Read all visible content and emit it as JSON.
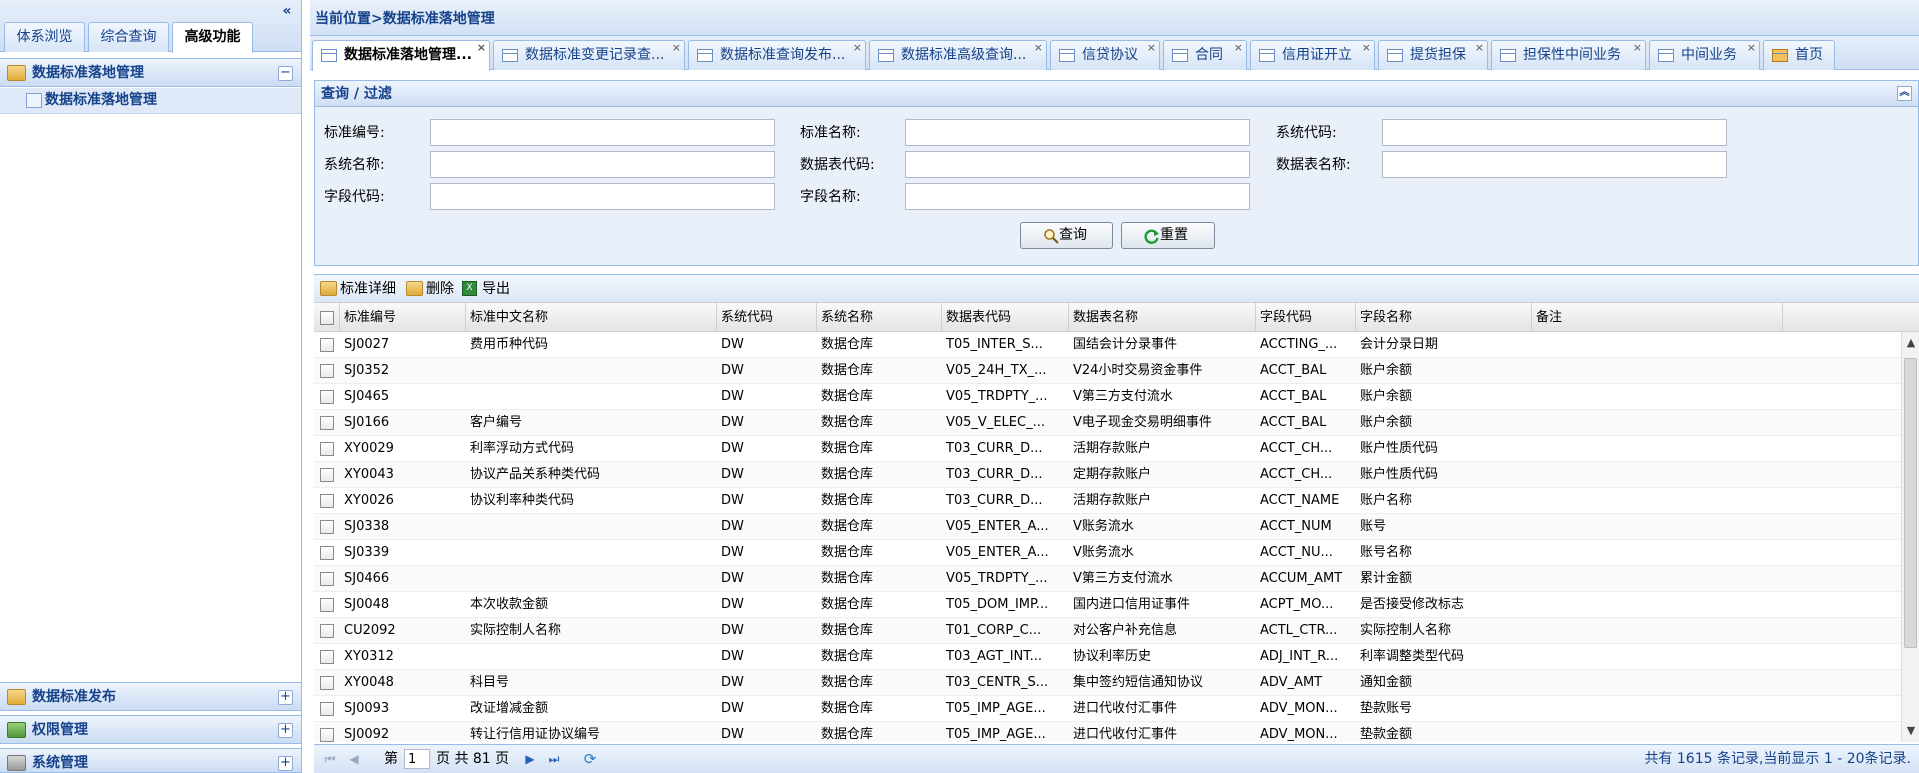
{
  "left": {
    "tabs": [
      "体系浏览",
      "综合查询",
      "高级功能"
    ],
    "collapse_glyph": "«",
    "sections": [
      {
        "label": "数据标准落地管理",
        "toggle": "−"
      },
      {
        "label": "数据标准发布",
        "toggle": "+"
      },
      {
        "label": "权限管理",
        "toggle": "+"
      },
      {
        "label": "系统管理",
        "toggle": "+"
      }
    ],
    "tree_item": "数据标准落地管理"
  },
  "breadcrumb": "当前位置>数据标准落地管理",
  "tabs": [
    {
      "label": "数据标准落地管理..."
    },
    {
      "label": "数据标准变更记录查..."
    },
    {
      "label": "数据标准查询发布..."
    },
    {
      "label": "数据标准高级查询..."
    },
    {
      "label": "信贷协议"
    },
    {
      "label": "合同"
    },
    {
      "label": "信用证开立"
    },
    {
      "label": "提货担保"
    },
    {
      "label": "担保性中间业务"
    },
    {
      "label": "中间业务"
    },
    {
      "label": "首页"
    }
  ],
  "filter": {
    "title": "查询 / 过滤",
    "fields": {
      "std_no": {
        "label": "标准编号:",
        "value": ""
      },
      "std_name": {
        "label": "标准名称:",
        "value": ""
      },
      "sys_code": {
        "label": "系统代码:",
        "value": ""
      },
      "sys_name": {
        "label": "系统名称:",
        "value": ""
      },
      "table_code": {
        "label": "数据表代码:",
        "value": ""
      },
      "table_name": {
        "label": "数据表名称:",
        "value": ""
      },
      "field_code": {
        "label": "字段代码:",
        "value": ""
      },
      "field_name": {
        "label": "字段名称:",
        "value": ""
      }
    },
    "query_label": "查询",
    "reset_label": "重置"
  },
  "toolbar": {
    "detail": "标准详细",
    "delete": "删除",
    "export": "导出",
    "export_glyph": "X"
  },
  "columns": [
    "标准编号",
    "标准中文名称",
    "系统代码",
    "系统名称",
    "数据表代码",
    "数据表名称",
    "字段代码",
    "字段名称",
    "备注"
  ],
  "rows": [
    [
      "SJ0027",
      "费用币种代码",
      "DW",
      "数据仓库",
      "T05_INTER_S...",
      "国结会计分录事件",
      "ACCTING_...",
      "会计分录日期",
      ""
    ],
    [
      "SJ0352",
      "",
      "DW",
      "数据仓库",
      "V05_24H_TX_...",
      "V24小时交易资金事件",
      "ACCT_BAL",
      "账户余额",
      ""
    ],
    [
      "SJ0465",
      "",
      "DW",
      "数据仓库",
      "V05_TRDPTY_...",
      "V第三方支付流水",
      "ACCT_BAL",
      "账户余额",
      ""
    ],
    [
      "SJ0166",
      "客户编号",
      "DW",
      "数据仓库",
      "V05_V_ELEC_...",
      "V电子现金交易明细事件",
      "ACCT_BAL",
      "账户余额",
      ""
    ],
    [
      "XY0029",
      "利率浮动方式代码",
      "DW",
      "数据仓库",
      "T03_CURR_D...",
      "活期存款账户",
      "ACCT_CH...",
      "账户性质代码",
      ""
    ],
    [
      "XY0043",
      "协议产品关系种类代码",
      "DW",
      "数据仓库",
      "T03_CURR_D...",
      "定期存款账户",
      "ACCT_CH...",
      "账户性质代码",
      ""
    ],
    [
      "XY0026",
      "协议利率种类代码",
      "DW",
      "数据仓库",
      "T03_CURR_D...",
      "活期存款账户",
      "ACCT_NAME",
      "账户名称",
      ""
    ],
    [
      "SJ0338",
      "",
      "DW",
      "数据仓库",
      "V05_ENTER_A...",
      "V账务流水",
      "ACCT_NUM",
      "账号",
      ""
    ],
    [
      "SJ0339",
      "",
      "DW",
      "数据仓库",
      "V05_ENTER_A...",
      "V账务流水",
      "ACCT_NU...",
      "账号名称",
      ""
    ],
    [
      "SJ0466",
      "",
      "DW",
      "数据仓库",
      "V05_TRDPTY_...",
      "V第三方支付流水",
      "ACCUM_AMT",
      "累计金额",
      ""
    ],
    [
      "SJ0048",
      "本次收款金额",
      "DW",
      "数据仓库",
      "T05_DOM_IMP...",
      "国内进口信用证事件",
      "ACPT_MO...",
      "是否接受修改标志",
      ""
    ],
    [
      "CU2092",
      "实际控制人名称",
      "DW",
      "数据仓库",
      "T01_CORP_C...",
      "对公客户补充信息",
      "ACTL_CTR...",
      "实际控制人名称",
      ""
    ],
    [
      "XY0312",
      "",
      "DW",
      "数据仓库",
      "T03_AGT_INT...",
      "协议利率历史",
      "ADJ_INT_R...",
      "利率调整类型代码",
      ""
    ],
    [
      "XY0048",
      "科目号",
      "DW",
      "数据仓库",
      "T03_CENTR_S...",
      "集中签约短信通知协议",
      "ADV_AMT",
      "通知金额",
      ""
    ],
    [
      "SJ0093",
      "改证增减金额",
      "DW",
      "数据仓库",
      "T05_IMP_AGE...",
      "进口代收付汇事件",
      "ADV_MON...",
      "垫款账号",
      ""
    ],
    [
      "SJ0092",
      "转让行信用证协议编号",
      "DW",
      "数据仓库",
      "T05_IMP_AGE...",
      "进口代收付汇事件",
      "ADV_MON...",
      "垫款金额",
      ""
    ]
  ],
  "pager": {
    "page_prefix": "第",
    "page_value": "1",
    "page_suffix": "页 共 81 页",
    "summary": "共有 1615 条记录,当前显示 1 - 20条记录."
  },
  "colors": {
    "header_blue": "#15428b",
    "border_blue": "#99bbe8",
    "panel_bg": "#e9f0fa"
  }
}
